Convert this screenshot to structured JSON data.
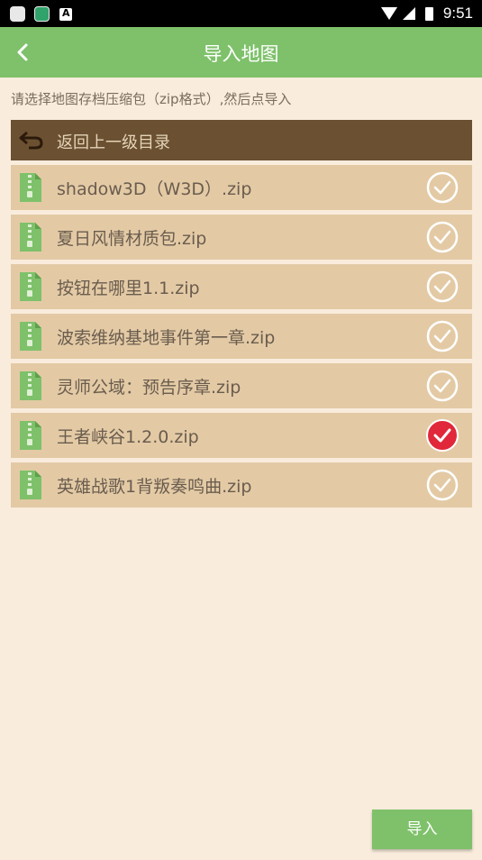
{
  "statusbar": {
    "time": "9:51"
  },
  "appbar": {
    "title": "导入地图"
  },
  "hint": "请选择地图存档压缩包（zip格式）,然后点导入",
  "parent_dir": {
    "label": "返回上一级目录"
  },
  "files": [
    {
      "name": "shadow3D（W3D）.zip",
      "checked": false
    },
    {
      "name": "夏日风情材质包.zip",
      "checked": false
    },
    {
      "name": "按钮在哪里1.1.zip",
      "checked": false
    },
    {
      "name": "波索维纳基地事件第一章.zip",
      "checked": false
    },
    {
      "name": "灵师公域：预告序章.zip",
      "checked": false
    },
    {
      "name": "王者峡谷1.2.0.zip",
      "checked": true
    },
    {
      "name": "英雄战歌1背叛奏鸣曲.zip",
      "checked": false
    }
  ],
  "import_button": {
    "label": "导入"
  },
  "colors": {
    "accent": "#7ec16a",
    "checked": "#e0283a",
    "row_bg": "#e3caa5",
    "parent_bg": "#6b5131"
  }
}
